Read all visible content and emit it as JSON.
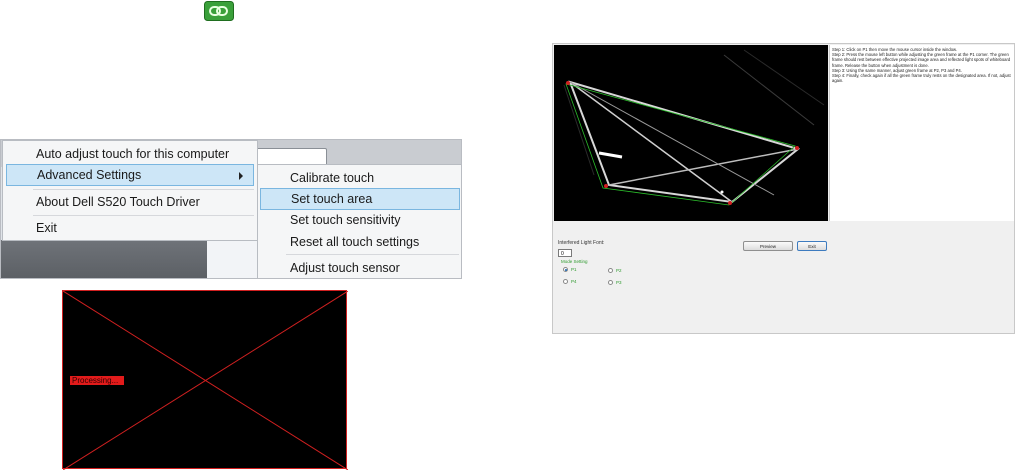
{
  "tray_icon": {
    "name": "link-chain-icon",
    "color": "#2f8f2f"
  },
  "menu": {
    "items": [
      "Auto adjust touch for this computer",
      "Advanced Settings",
      "About Dell S520 Touch Driver",
      "Exit"
    ],
    "highlighted": "Advanced Settings",
    "submenu": [
      "Calibrate touch",
      "Set touch area",
      "Set touch sensitivity",
      "Reset all touch settings",
      "Adjust touch sensor"
    ],
    "submenu_highlighted": "Set touch area",
    "highlight_color": "#cde6f7"
  },
  "processing": {
    "label": "Processing...",
    "border_color": "#d12020"
  },
  "calibration": {
    "instructions": [
      "Step 1: Click on P1 then move the mouse cursor inside the window.",
      "Step 2: Press the mouse left button while adjusting the green frame at the P1 corner. The green frame should rest between effective projected image area and reflected light spots of whiteboard frame. Release the button when adjustment is done.",
      "Step 3: Using the same manner, adjust green frame at P2, P3 and P4.",
      "Step 4: Finally, check again if all the green frame truly rests on the designated area. If not, adjust again."
    ],
    "interfered_light_label": "Interfered Light Font:",
    "interfered_light_value": "0",
    "preview_button": "Preview",
    "exit_button": "Exit",
    "mode_label": "Mode Setting",
    "points": [
      "P1",
      "P2",
      "P3",
      "P4"
    ],
    "selected_point": "P1",
    "corner_labels": [
      "P1",
      "P2",
      "P3",
      "P4"
    ],
    "frame_color": "#2bbd2b"
  }
}
